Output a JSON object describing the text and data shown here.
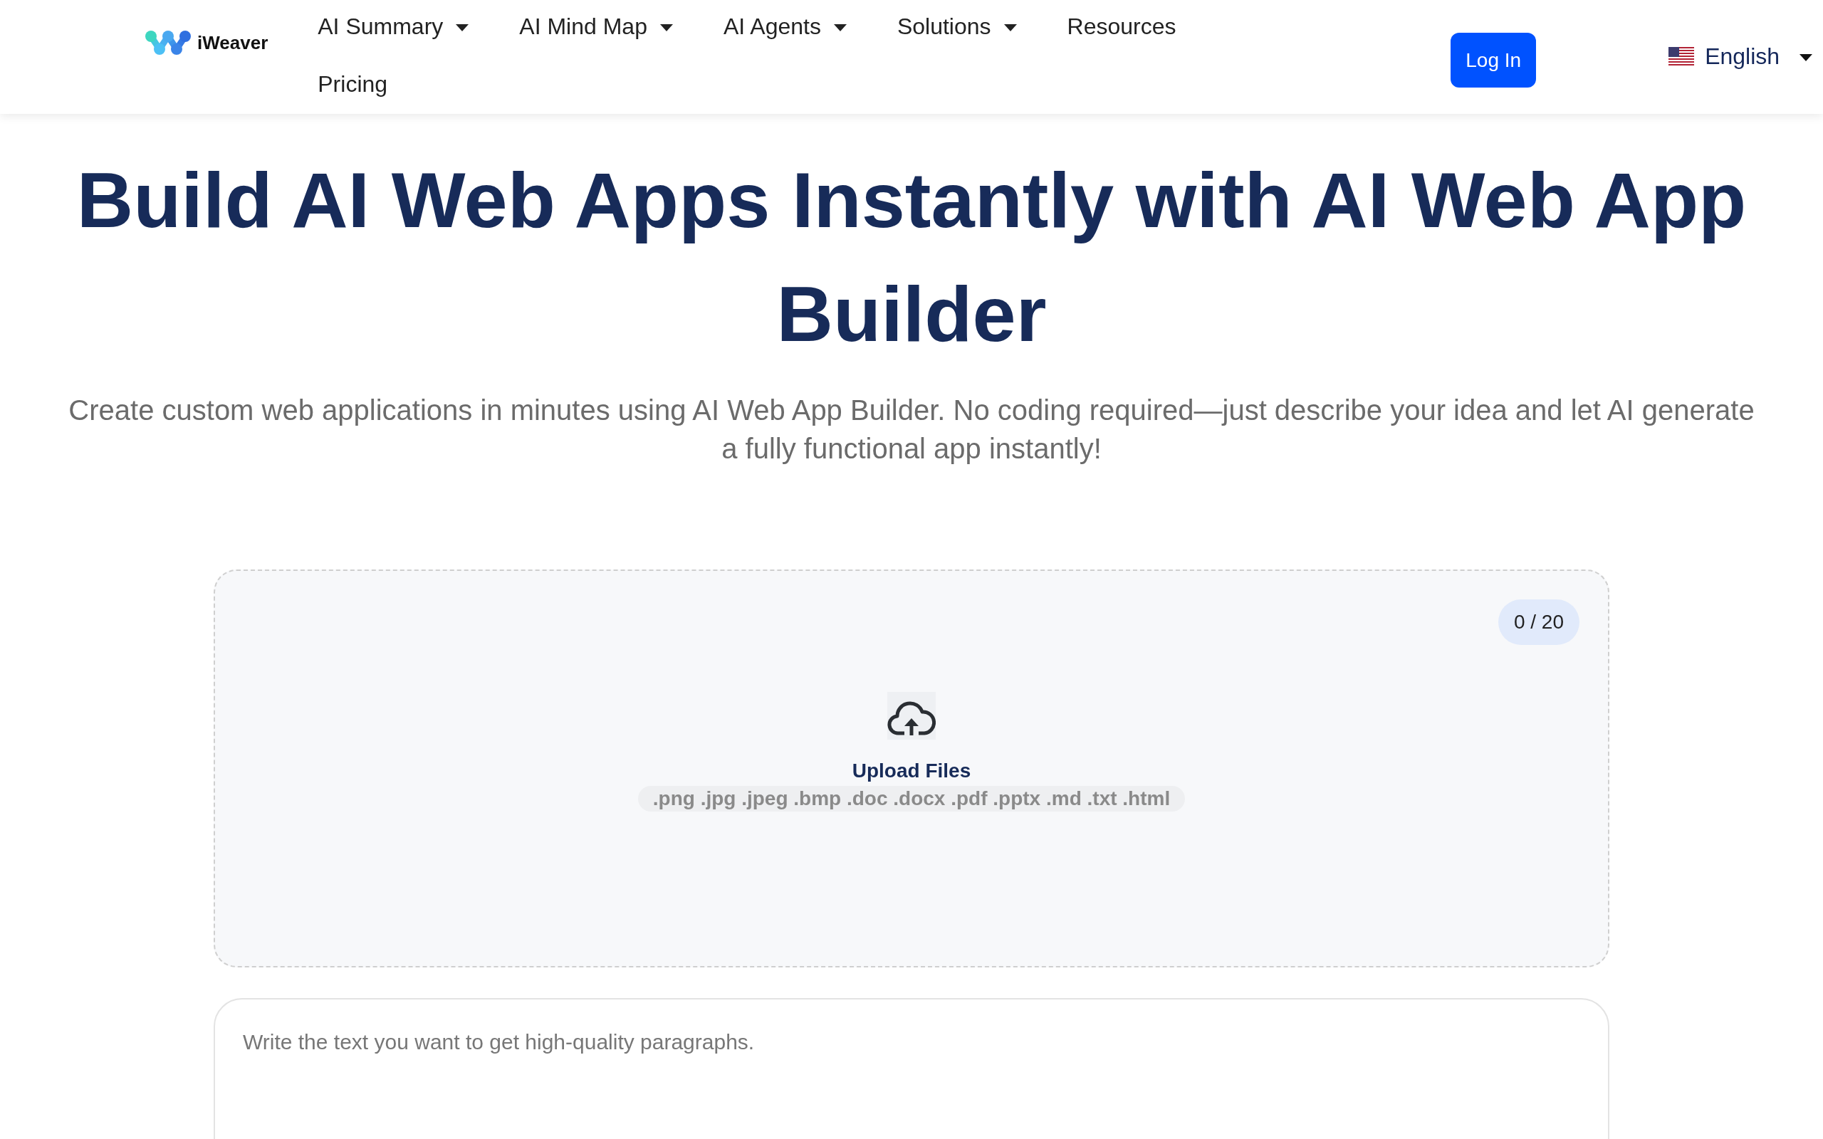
{
  "header": {
    "logo": {
      "text": "iWeaver"
    },
    "nav": [
      {
        "label": "AI Summary",
        "has_menu": true
      },
      {
        "label": "AI Mind Map",
        "has_menu": true
      },
      {
        "label": "AI Agents",
        "has_menu": true
      },
      {
        "label": "Solutions",
        "has_menu": true
      },
      {
        "label": "Resources",
        "has_menu": false
      },
      {
        "label": "Pricing",
        "has_menu": false
      }
    ],
    "login_button": "Log In",
    "language": {
      "label": "English"
    }
  },
  "hero": {
    "title": "Build AI Web Apps Instantly with AI Web App Builder",
    "subtitle": "Create custom web applications in minutes using AI Web App Builder. No coding required—just describe your idea and let AI generate a fully functional app instantly!"
  },
  "upload": {
    "counter": "0 / 20",
    "label": "Upload Files",
    "formats": ".png .jpg .jpeg .bmp .doc .docx .pdf .pptx .md .txt .html"
  },
  "prompt": {
    "placeholder": "Write the text you want to get high-quality paragraphs."
  }
}
